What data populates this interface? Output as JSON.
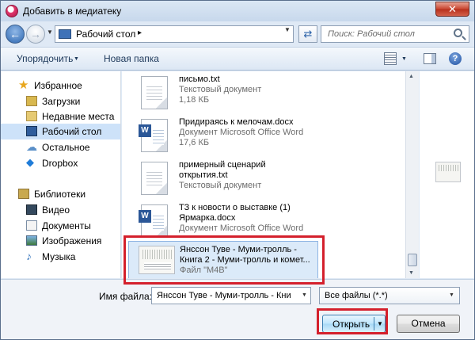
{
  "window": {
    "title": "Добавить в медиатеку",
    "close_label": "✕"
  },
  "address": {
    "location": "Рабочий стол",
    "separator": "▸",
    "search_placeholder": "Поиск: Рабочий стол"
  },
  "toolbar": {
    "organize_label": "Упорядочить",
    "new_folder_label": "Новая папка",
    "help_label": "?"
  },
  "sidebar": {
    "items": [
      {
        "label": "Избранное",
        "icon": "star-icon"
      },
      {
        "label": "Загрузки",
        "icon": "downloads-folder-icon"
      },
      {
        "label": "Недавние места",
        "icon": "recent-places-icon"
      },
      {
        "label": "Рабочий стол",
        "icon": "desktop-icon",
        "selected": true
      },
      {
        "label": "Остальное",
        "icon": "cloud-icon"
      },
      {
        "label": "Dropbox",
        "icon": "dropbox-icon"
      },
      {
        "label": "Библиотеки",
        "icon": "libraries-icon"
      },
      {
        "label": "Видео",
        "icon": "video-library-icon"
      },
      {
        "label": "Документы",
        "icon": "documents-library-icon"
      },
      {
        "label": "Изображения",
        "icon": "images-library-icon"
      },
      {
        "label": "Музыка",
        "icon": "music-library-icon"
      }
    ]
  },
  "files": [
    {
      "name": "письмо.txt",
      "type": "Текстовый документ",
      "size": "1,18 КБ"
    },
    {
      "name": "Придираясь к мелочам.docx",
      "type": "Документ Microsoft Office Word",
      "size": "17,6 КБ"
    },
    {
      "name": "примерный сценарий",
      "name2": "открытия.txt",
      "type": "Текстовый документ"
    },
    {
      "name": "ТЗ к новости о выставке (1)",
      "name2": "Ярмарка.docx",
      "type": "Документ Microsoft Office Word"
    },
    {
      "name": "Янссон Туве - Муми-тролль -",
      "name2": "Книга 2 - Муми-тролль и комет...",
      "type": "Файл \"M4B\"",
      "selected": true
    }
  ],
  "bottom": {
    "filename_label": "Имя файла:",
    "filename_value": "Янссон Туве - Муми-тролль - Кни",
    "filter_value": "Все файлы (*.*)",
    "open_label": "Открыть",
    "cancel_label": "Отмена"
  },
  "colors": {
    "highlight_frame": "#d4202c",
    "selection": "#dbeaf9",
    "accent": "#3c7fb1"
  }
}
